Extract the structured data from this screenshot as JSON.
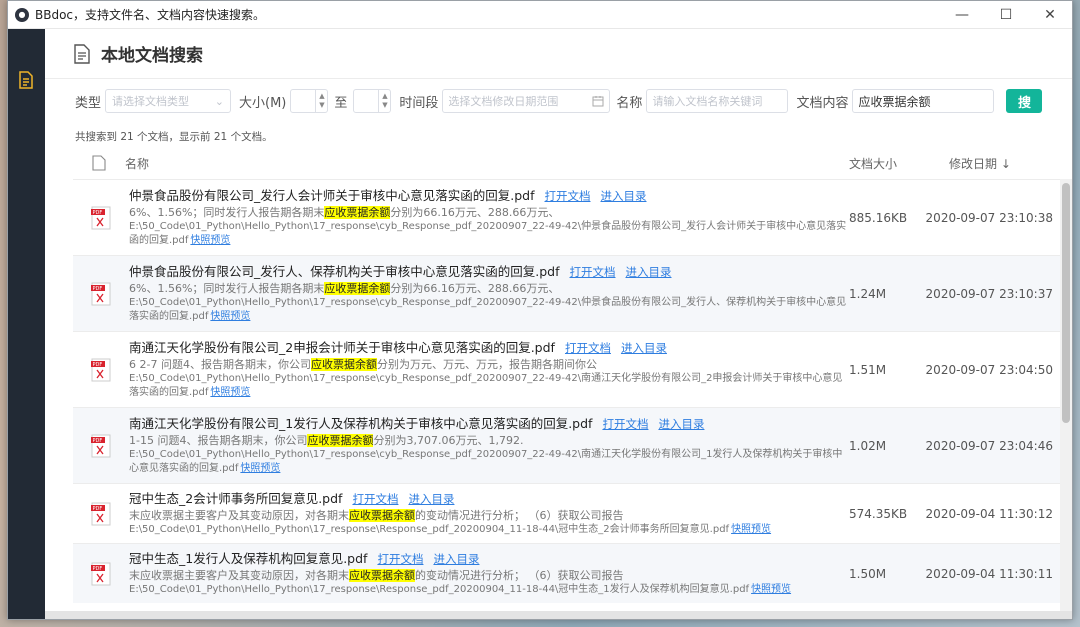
{
  "window": {
    "title": "BBdoc，支持文件名、文档内容快速搜索。",
    "minimize": "—",
    "maximize": "☐",
    "close": "✕"
  },
  "header": {
    "title": "本地文档搜索"
  },
  "filters": {
    "type_label": "类型",
    "type_placeholder": "请选择文档类型",
    "size_label": "大小(M)",
    "to_label": "至",
    "period_label": "时间段",
    "period_placeholder": "选择文档修改日期范围",
    "name_label": "名称",
    "name_placeholder": "请输入文档名称关键词",
    "content_label": "文档内容",
    "content_value": "应收票据余额",
    "search_button": "搜"
  },
  "summary": "共搜索到 21 个文档，显示前 21 个文档。",
  "table": {
    "col_name": "名称",
    "col_size": "文档大小",
    "col_date": "修改日期 ↓",
    "link_open": "打开文档",
    "link_dir": "进入目录",
    "link_preview": "快照预览",
    "rows": [
      {
        "title": "仲景食品股份有限公司_发行人会计师关于审核中心意见落实函的回复.pdf",
        "snip_pre": "6%、1.56%；同时发行人报告期各期末",
        "snip_hl": "应收票据余额",
        "snip_post": "分别为66.16万元、288.66万元、",
        "path": "E:\\50_Code\\01_Python\\Hello_Python\\17_response\\cyb_Response_pdf_20200907_22-49-42\\仲景食品股份有限公司_发行人会计师关于审核中心意见落实函的回复.pdf",
        "size": "885.16KB",
        "date": "2020-09-07 23:10:38"
      },
      {
        "title": "仲景食品股份有限公司_发行人、保荐机构关于审核中心意见落实函的回复.pdf",
        "snip_pre": "6%、1.56%；同时发行人报告期各期末",
        "snip_hl": "应收票据余额",
        "snip_post": "分别为66.16万元、288.66万元、",
        "path": "E:\\50_Code\\01_Python\\Hello_Python\\17_response\\cyb_Response_pdf_20200907_22-49-42\\仲景食品股份有限公司_发行人、保荐机构关于审核中心意见落实函的回复.pdf",
        "size": "1.24M",
        "date": "2020-09-07 23:10:37"
      },
      {
        "title": "南通江天化学股份有限公司_2申报会计师关于审核中心意见落实函的回复.pdf",
        "snip_pre": "6 2-7 问题4、报告期各期末，你公司",
        "snip_hl": "应收票据余额",
        "snip_post": "分别为万元、万元、万元，报告期各期间你公",
        "path": "E:\\50_Code\\01_Python\\Hello_Python\\17_response\\cyb_Response_pdf_20200907_22-49-42\\南通江天化学股份有限公司_2申报会计师关于审核中心意见落实函的回复.pdf",
        "size": "1.51M",
        "date": "2020-09-07 23:04:50"
      },
      {
        "title": "南通江天化学股份有限公司_1发行人及保荐机构关于审核中心意见落实函的回复.pdf",
        "snip_pre": "1-15 问题4、报告期各期末，你公司",
        "snip_hl": "应收票据余额",
        "snip_post": "分别为3,707.06万元、1,792.",
        "path": "E:\\50_Code\\01_Python\\Hello_Python\\17_response\\cyb_Response_pdf_20200907_22-49-42\\南通江天化学股份有限公司_1发行人及保荐机构关于审核中心意见落实函的回复.pdf",
        "size": "1.02M",
        "date": "2020-09-07 23:04:46"
      },
      {
        "title": "冠中生态_2会计师事务所回复意见.pdf",
        "snip_pre": "末应收票据主要客户及其变动原因，对各期末",
        "snip_hl": "应收票据余额",
        "snip_post": "的变动情况进行分析；  （6）获取公司报告",
        "path": "E:\\50_Code\\01_Python\\Hello_Python\\17_response\\Response_pdf_20200904_11-18-44\\冠中生态_2会计师事务所回复意见.pdf",
        "size": "574.35KB",
        "date": "2020-09-04 11:30:12"
      },
      {
        "title": "冠中生态_1发行人及保荐机构回复意见.pdf",
        "snip_pre": "末应收票据主要客户及其变动原因，对各期末",
        "snip_hl": "应收票据余额",
        "snip_post": "的变动情况进行分析；  （6）获取公司报告",
        "path": "E:\\50_Code\\01_Python\\Hello_Python\\17_response\\Response_pdf_20200904_11-18-44\\冠中生态_1发行人及保荐机构回复意见.pdf",
        "size": "1.50M",
        "date": "2020-09-04 11:30:11"
      }
    ]
  },
  "colors": {
    "accent": "#13b59a",
    "sidebar": "#222a35",
    "link": "#2f7ee0",
    "highlight": "#ffff00"
  }
}
